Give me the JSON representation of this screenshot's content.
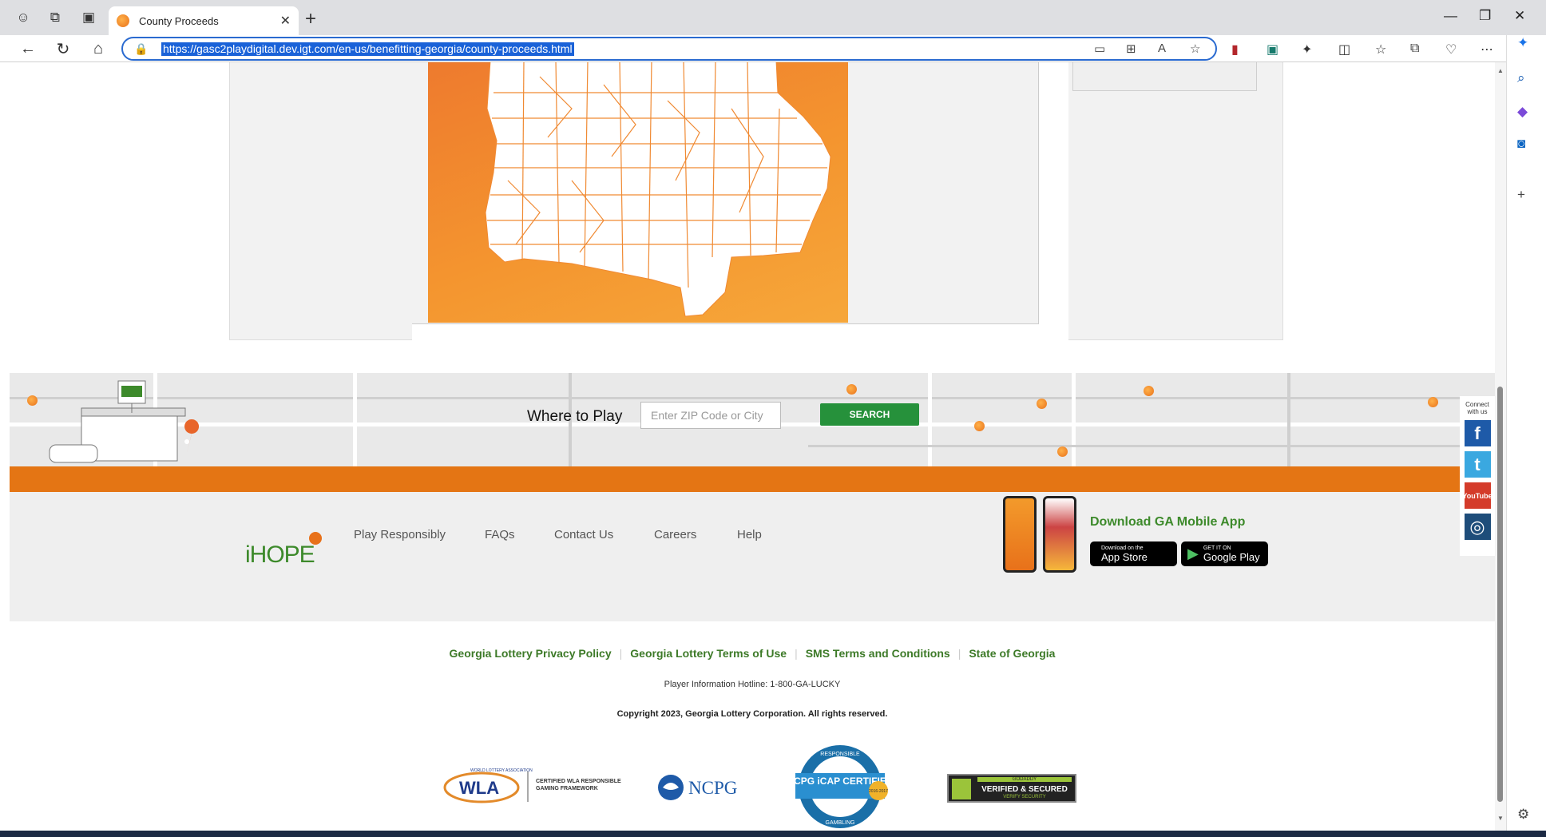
{
  "browser": {
    "tab_title": "County Proceeds",
    "url": "https://gasc2playdigital.dev.igt.com/en-us/benefitting-georgia/county-proceeds.html"
  },
  "where_to_play": {
    "label": "Where to Play",
    "zip_placeholder": "Enter ZIP Code or City",
    "search_label": "SEARCH"
  },
  "footer": {
    "ihope_logo": "iHOPE",
    "nav": [
      "Play Responsibly",
      "FAQs",
      "Contact Us",
      "Careers",
      "Help"
    ],
    "app_title": "Download GA Mobile App",
    "app_store_small": "Download on the",
    "app_store": "App Store",
    "google_play_small": "GET IT ON",
    "google_play": "Google Play",
    "connect": "Connect with us",
    "social": [
      "f",
      "t",
      "YouTube",
      "◎"
    ]
  },
  "legal": {
    "links": [
      "Georgia Lottery Privacy Policy",
      "Georgia Lottery Terms of Use",
      "SMS Terms and Conditions",
      "State of Georgia"
    ],
    "hotline": "Player Information Hotline: 1-800-GA-LUCKY",
    "copyright": "Copyright 2023, Georgia Lottery Corporation. All rights reserved."
  },
  "badges": {
    "wla": "WLA",
    "wla_small": "WORLD LOTTERY ASSOCIATION",
    "wla_text": "CERTIFIED WLA RESPONSIBLE GAMING FRAMEWORK",
    "ncpg": "NCPG",
    "icap_top": "RESPONSIBLE",
    "icap": "NCPG iCAP CERTIFIED",
    "icap_bottom": "GAMBLING",
    "icap_years": "2016-2017",
    "godaddy_top": "GODADDY",
    "godaddy": "VERIFIED & SECURED",
    "godaddy_bottom": "VERIFY SECURITY"
  },
  "colors": {
    "orange": "#e47514",
    "green": "#3d8a2b",
    "search_green": "#26913b"
  }
}
